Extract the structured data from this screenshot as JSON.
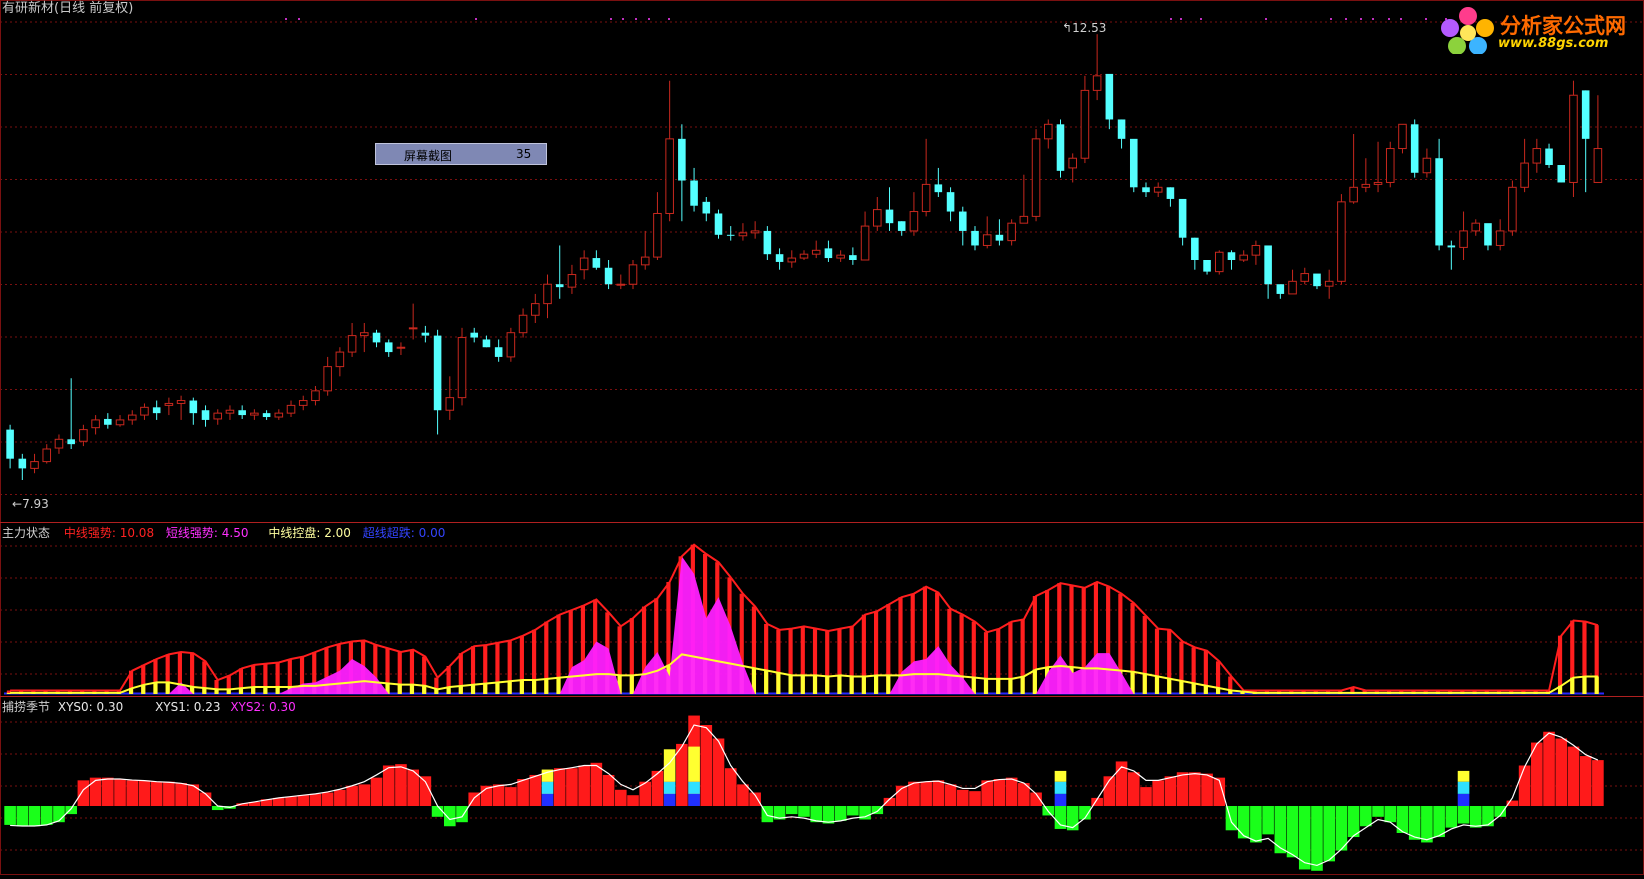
{
  "header": {
    "title": "有研新材(日线 前复权)",
    "popup_label": "屏幕截图",
    "popup_value": "35",
    "max_label": "12.53",
    "min_label": "7.93"
  },
  "logo": {
    "name": "分析家公式网",
    "url": "www.88gs.com"
  },
  "colors": {
    "bg": "#000000",
    "up": "#c8281e",
    "down": "#54ffff",
    "grid": "#7a1010",
    "mid": "#ff1e1e",
    "short": "#ff20ff",
    "ctrl": "#ffff30",
    "super": "#2828ff",
    "pos": "#ff1a1a",
    "neg": "#1aff1a",
    "line": "#ffffff"
  },
  "panel2": {
    "name": "主力状态",
    "items": [
      {
        "label": "中线强势:",
        "value": "10.08",
        "color": "#ff2222"
      },
      {
        "label": "短线强势:",
        "value": "4.50",
        "color": "#ff30ff"
      },
      {
        "label": "中线控盘:",
        "value": "2.00",
        "color": "#ffffa0"
      },
      {
        "label": "超线超跌:",
        "value": "0.00",
        "color": "#3344ff"
      }
    ]
  },
  "panel3": {
    "name": "捕捞季节",
    "items": [
      {
        "label": "XYS0:",
        "value": "0.30",
        "color": "#e8e8e8"
      },
      {
        "label": "XYS1:",
        "value": "0.23",
        "color": "#e8e8e8"
      },
      {
        "label": "XYS2:",
        "value": "0.30",
        "color": "#ff30ff"
      }
    ]
  },
  "chart_data": {
    "type": "candlestick",
    "ylim": [
      7.6,
      12.8
    ],
    "close": [
      8.15,
      8.05,
      8.12,
      8.25,
      8.35,
      8.3,
      8.45,
      8.55,
      8.5,
      8.55,
      8.6,
      8.68,
      8.62,
      8.72,
      8.75,
      8.62,
      8.55,
      8.62,
      8.65,
      8.6,
      8.62,
      8.58,
      8.62,
      8.7,
      8.75,
      8.85,
      9.1,
      9.25,
      9.42,
      9.45,
      9.35,
      9.25,
      9.3,
      9.5,
      9.42,
      8.65,
      8.78,
      9.4,
      9.4,
      9.3,
      9.2,
      9.45,
      9.63,
      9.75,
      9.95,
      9.92,
      10.05,
      10.22,
      10.12,
      9.95,
      9.95,
      10.15,
      10.23,
      10.68,
      11.45,
      11.02,
      10.76,
      10.68,
      10.46,
      10.45,
      10.48,
      10.5,
      10.26,
      10.18,
      10.22,
      10.26,
      10.3,
      10.22,
      10.25,
      10.2,
      10.55,
      10.72,
      10.58,
      10.5,
      10.7,
      10.98,
      10.9,
      10.7,
      10.5,
      10.35,
      10.46,
      10.4,
      10.58,
      10.65,
      11.45,
      11.6,
      11.12,
      11.25,
      11.95,
      12.1,
      11.65,
      11.45,
      10.95,
      10.9,
      10.95,
      10.83,
      10.43,
      10.2,
      10.08,
      10.28,
      10.2,
      10.25,
      10.35,
      9.95,
      9.85,
      9.98,
      10.06,
      9.93,
      9.98,
      10.8,
      10.95,
      10.98,
      11.0,
      11.35,
      11.6,
      11.1,
      11.25,
      10.35,
      10.33,
      10.5,
      10.58,
      10.35,
      10.5,
      10.95,
      11.2,
      11.35,
      11.18,
      11.0,
      11.9,
      11.45,
      11.35
    ],
    "open": [
      8.45,
      8.15,
      8.05,
      8.12,
      8.26,
      8.35,
      8.33,
      8.47,
      8.56,
      8.5,
      8.55,
      8.6,
      8.68,
      8.7,
      8.72,
      8.75,
      8.65,
      8.56,
      8.62,
      8.65,
      8.6,
      8.62,
      8.58,
      8.62,
      8.7,
      8.75,
      8.85,
      9.1,
      9.25,
      9.42,
      9.45,
      9.35,
      9.3,
      9.5,
      9.45,
      9.42,
      8.65,
      8.78,
      9.45,
      9.38,
      9.3,
      9.2,
      9.45,
      9.63,
      9.75,
      9.95,
      9.92,
      10.1,
      10.22,
      10.12,
      9.95,
      9.95,
      10.15,
      10.23,
      10.68,
      11.45,
      11.02,
      10.8,
      10.68,
      10.46,
      10.45,
      10.48,
      10.5,
      10.26,
      10.18,
      10.22,
      10.26,
      10.32,
      10.22,
      10.25,
      10.2,
      10.55,
      10.72,
      10.6,
      10.5,
      10.7,
      10.98,
      10.9,
      10.7,
      10.5,
      10.35,
      10.46,
      10.4,
      10.58,
      10.65,
      11.45,
      11.6,
      11.15,
      11.25,
      11.95,
      12.12,
      11.65,
      11.45,
      10.95,
      10.9,
      10.95,
      10.83,
      10.43,
      10.2,
      10.08,
      10.28,
      10.2,
      10.25,
      10.35,
      9.95,
      9.85,
      9.98,
      10.06,
      9.93,
      9.98,
      10.8,
      10.95,
      10.98,
      11.0,
      11.35,
      11.6,
      11.1,
      11.25,
      10.35,
      10.33,
      10.5,
      10.58,
      10.35,
      10.5,
      10.95,
      11.2,
      11.35,
      11.18,
      11.0,
      11.95,
      11.0
    ],
    "high": [
      8.5,
      8.2,
      8.2,
      8.3,
      8.4,
      8.98,
      8.5,
      8.6,
      8.62,
      8.6,
      8.65,
      8.72,
      8.75,
      8.78,
      8.8,
      8.78,
      8.7,
      8.66,
      8.7,
      8.7,
      8.66,
      8.65,
      8.66,
      8.75,
      8.8,
      8.9,
      9.2,
      9.3,
      9.55,
      9.55,
      9.48,
      9.38,
      9.35,
      9.75,
      9.52,
      9.48,
      9.0,
      9.5,
      9.5,
      9.42,
      9.38,
      9.5,
      9.7,
      9.85,
      10.05,
      10.35,
      10.15,
      10.3,
      10.3,
      10.2,
      10.05,
      10.2,
      10.5,
      10.9,
      12.05,
      11.6,
      11.15,
      10.85,
      10.72,
      10.55,
      10.58,
      10.6,
      10.55,
      10.32,
      10.3,
      10.3,
      10.4,
      10.4,
      10.3,
      10.33,
      10.7,
      10.85,
      10.95,
      10.6,
      10.9,
      11.45,
      11.15,
      10.95,
      10.75,
      10.55,
      10.65,
      10.62,
      10.62,
      11.08,
      11.55,
      11.65,
      11.65,
      11.3,
      12.1,
      12.53,
      12.0,
      11.65,
      11.4,
      11.0,
      11.0,
      10.95,
      10.62,
      10.43,
      10.2,
      10.3,
      10.3,
      10.3,
      10.4,
      10.0,
      9.9,
      10.1,
      10.12,
      10.05,
      10.1,
      10.88,
      11.5,
      11.25,
      11.42,
      11.42,
      11.6,
      11.65,
      11.35,
      11.45,
      10.4,
      10.7,
      10.62,
      10.55,
      10.62,
      11.02,
      11.45,
      11.45,
      11.4,
      11.18,
      12.05,
      11.95,
      11.9
    ],
    "low": [
      8.05,
      7.93,
      8.0,
      8.1,
      8.2,
      8.25,
      8.28,
      8.4,
      8.46,
      8.48,
      8.5,
      8.55,
      8.55,
      8.6,
      8.55,
      8.5,
      8.48,
      8.5,
      8.55,
      8.56,
      8.55,
      8.55,
      8.55,
      8.58,
      8.65,
      8.7,
      8.8,
      9.0,
      9.2,
      9.25,
      9.3,
      9.2,
      9.22,
      9.38,
      9.35,
      8.4,
      8.55,
      8.7,
      9.35,
      9.3,
      9.15,
      9.15,
      9.4,
      9.55,
      9.6,
      9.8,
      9.85,
      10.0,
      10.1,
      9.9,
      9.9,
      9.9,
      10.1,
      10.2,
      10.6,
      10.6,
      10.7,
      10.6,
      10.42,
      10.4,
      10.4,
      10.42,
      10.2,
      10.1,
      10.12,
      10.2,
      10.22,
      10.18,
      10.18,
      10.15,
      10.2,
      10.5,
      10.5,
      10.45,
      10.45,
      10.65,
      10.85,
      10.6,
      10.35,
      10.3,
      10.32,
      10.35,
      10.35,
      10.6,
      10.6,
      11.35,
      11.05,
      11.0,
      11.2,
      11.85,
      11.55,
      11.35,
      10.9,
      10.85,
      10.85,
      10.75,
      10.35,
      10.1,
      10.05,
      10.05,
      10.1,
      10.18,
      10.15,
      9.8,
      9.8,
      9.85,
      9.95,
      9.9,
      9.8,
      9.95,
      10.78,
      10.9,
      10.9,
      10.95,
      11.3,
      11.05,
      11.05,
      10.3,
      10.1,
      10.2,
      10.45,
      10.3,
      10.3,
      10.45,
      10.9,
      11.1,
      11.15,
      11.0,
      10.85,
      10.9,
      11.3
    ],
    "mid_strength": [
      0.3,
      0.3,
      0.3,
      0.3,
      0.3,
      0.3,
      0.3,
      0.3,
      0.3,
      0.3,
      2.0,
      2.5,
      3.0,
      3.4,
      3.6,
      3.5,
      2.8,
      1.2,
      1.6,
      2.2,
      2.5,
      2.6,
      2.7,
      3.0,
      3.2,
      3.6,
      4.0,
      4.3,
      4.5,
      4.6,
      4.2,
      3.9,
      3.6,
      3.8,
      3.2,
      1.4,
      2.4,
      3.5,
      4.1,
      4.2,
      4.4,
      4.6,
      5.0,
      5.5,
      6.2,
      6.8,
      7.2,
      7.6,
      8.1,
      7.0,
      5.8,
      6.5,
      7.5,
      8.2,
      9.6,
      11.8,
      12.8,
      12.0,
      11.3,
      10.0,
      8.6,
      7.5,
      6.0,
      5.5,
      5.6,
      5.8,
      5.6,
      5.4,
      5.6,
      5.8,
      6.8,
      7.1,
      7.7,
      8.3,
      8.6,
      9.2,
      8.7,
      7.3,
      6.8,
      6.2,
      5.3,
      5.6,
      6.2,
      6.4,
      8.4,
      8.9,
      9.5,
      9.3,
      9.1,
      9.6,
      9.2,
      8.6,
      7.8,
      6.7,
      5.6,
      5.5,
      4.5,
      4.0,
      3.7,
      2.8,
      1.5,
      0.3,
      0.3,
      0.3,
      0.3,
      0.3,
      0.3,
      0.3,
      0.3,
      0.3,
      0.6,
      0.3,
      0.3,
      0.3,
      0.3,
      0.3,
      0.3,
      0.3,
      0.3,
      0.3,
      0.3,
      0.3,
      0.3,
      0.3,
      0.3,
      0.3,
      0.3,
      5.0,
      6.3,
      6.2,
      5.9,
      7.4,
      7.0,
      4.2,
      3.7,
      3.3,
      1.8,
      1.0,
      0.6,
      0.3,
      1.3,
      5.0,
      7.0,
      8.0,
      7.5,
      8.0,
      8.6,
      6.0,
      4.5,
      6.8
    ],
    "short_strength": [
      0,
      0,
      0,
      0,
      0,
      0,
      0,
      0,
      0,
      0,
      0,
      0,
      0,
      0,
      1.0,
      0,
      0,
      0,
      0,
      0,
      0,
      0,
      0,
      0.5,
      0.9,
      1.0,
      1.5,
      2.0,
      3.0,
      2.4,
      1.4,
      0,
      0,
      0,
      0,
      0,
      0,
      0,
      0,
      0,
      0,
      0,
      0,
      0,
      0,
      0,
      2.3,
      2.9,
      4.5,
      3.9,
      0,
      0,
      2.3,
      3.6,
      1.5,
      11.8,
      10.3,
      6.5,
      8.3,
      5.8,
      2.6,
      0,
      0,
      0,
      0,
      0,
      0,
      0,
      0,
      0,
      0,
      0,
      0,
      1.9,
      2.8,
      3.0,
      4.1,
      2.5,
      1.4,
      0,
      0,
      0,
      0,
      0,
      0,
      1.9,
      3.3,
      1.8,
      2.3,
      3.5,
      3.5,
      1.8,
      0,
      0,
      0,
      0,
      0,
      0,
      0,
      0,
      0,
      0,
      0,
      0,
      0,
      0,
      0,
      0,
      0,
      0,
      0,
      0,
      0,
      0,
      0,
      0,
      0,
      0,
      0,
      0,
      0,
      0,
      0,
      0,
      0,
      0,
      0,
      0,
      0,
      0,
      0,
      0,
      0,
      0,
      0,
      0,
      0,
      0,
      0,
      0,
      0,
      0,
      0,
      0,
      0,
      0,
      0,
      0,
      0,
      0,
      0,
      0,
      0,
      0,
      0,
      1.8,
      3.0,
      0,
      2.5,
      4.5,
      2.0,
      3.5
    ],
    "ctrl": [
      0.1,
      0.1,
      0.1,
      0.1,
      0.1,
      0.1,
      0.1,
      0.1,
      0.1,
      0.1,
      0.5,
      0.8,
      1.0,
      1.0,
      0.8,
      0.6,
      0.5,
      0.4,
      0.4,
      0.5,
      0.6,
      0.6,
      0.6,
      0.6,
      0.7,
      0.7,
      0.8,
      0.9,
      1.0,
      1.1,
      1.0,
      0.9,
      0.8,
      0.8,
      0.7,
      0.4,
      0.6,
      0.7,
      0.8,
      0.9,
      1.0,
      1.1,
      1.2,
      1.2,
      1.3,
      1.4,
      1.5,
      1.6,
      1.7,
      1.7,
      1.6,
      1.6,
      1.7,
      2.0,
      2.5,
      3.4,
      3.2,
      3.0,
      2.8,
      2.6,
      2.4,
      2.2,
      2.0,
      1.8,
      1.6,
      1.6,
      1.6,
      1.5,
      1.6,
      1.5,
      1.5,
      1.6,
      1.6,
      1.6,
      1.7,
      1.7,
      1.7,
      1.6,
      1.5,
      1.4,
      1.3,
      1.3,
      1.3,
      1.5,
      2.1,
      2.3,
      2.4,
      2.3,
      2.2,
      2.2,
      2.1,
      2.0,
      1.9,
      1.7,
      1.5,
      1.3,
      1.1,
      0.9,
      0.7,
      0.5,
      0.3,
      0.2,
      0.1,
      0.1,
      0.1,
      0.1,
      0.1,
      0.1,
      0.1,
      0.1,
      0.1,
      0.1,
      0.1,
      0.1,
      0.1,
      0.1,
      0.1,
      0.1,
      0.1,
      0.1,
      0.1,
      0.1,
      0.1,
      0.1,
      0.1,
      0.1,
      0.1,
      0.7,
      1.4,
      1.5,
      1.5,
      1.5,
      1.6,
      1.4,
      1.2,
      1.0,
      0.8,
      0.6,
      0.4,
      0.3,
      0.6,
      1.2,
      1.5,
      1.8,
      1.8,
      1.9,
      2.0,
      1.9,
      1.8,
      2.0
    ],
    "xys0": [
      -0.7,
      -0.75,
      -0.75,
      -0.7,
      -0.6,
      -0.3,
      0.95,
      1.05,
      1.05,
      1.0,
      0.95,
      0.95,
      0.9,
      0.9,
      0.85,
      0.8,
      0.5,
      -0.15,
      -0.1,
      0.1,
      0.15,
      0.25,
      0.3,
      0.35,
      0.4,
      0.45,
      0.5,
      0.6,
      0.75,
      0.8,
      1.05,
      1.5,
      1.55,
      1.35,
      1.1,
      -0.4,
      -0.75,
      -0.6,
      0.5,
      0.75,
      0.8,
      0.7,
      1.0,
      1.15,
      1.3,
      1.4,
      1.4,
      1.5,
      1.6,
      1.15,
      0.6,
      0.4,
      0.9,
      1.3,
      1.7,
      2.3,
      3.35,
      3.0,
      2.5,
      1.4,
      0.8,
      0.5,
      -0.6,
      -0.5,
      -0.3,
      -0.4,
      -0.6,
      -0.65,
      -0.55,
      -0.35,
      -0.5,
      -0.3,
      0.3,
      0.75,
      0.9,
      0.9,
      0.95,
      0.8,
      0.6,
      0.55,
      0.95,
      1.0,
      1.05,
      0.85,
      0.5,
      -0.35,
      -0.85,
      -0.9,
      -0.5,
      0.3,
      1.1,
      1.65,
      1.25,
      0.7,
      0.95,
      1.1,
      1.25,
      1.25,
      1.2,
      1.05,
      -0.9,
      -1.2,
      -1.35,
      -1.05,
      -1.75,
      -1.9,
      -2.35,
      -2.4,
      -2.05,
      -1.65,
      -1.15,
      -0.75,
      -0.4,
      -0.6,
      -1.0,
      -1.25,
      -1.35,
      -1.15,
      -0.8,
      -0.65,
      -0.8,
      -0.75,
      -0.4,
      0.2,
      1.5,
      2.35,
      2.75,
      2.5,
      2.2,
      1.85,
      1.7,
      1.3,
      1.0,
      0.55,
      0.3,
      -1.4,
      -2.1,
      -2.4,
      -1.9,
      -1.35,
      -1.0,
      -0.6,
      -0.3,
      0.3,
      1.0,
      1.5,
      1.25,
      1.3,
      1.2,
      1.1,
      1.15,
      1.05,
      0.25,
      0.3
    ],
    "xys2_line": [
      -0.72,
      -0.74,
      -0.74,
      -0.7,
      -0.55,
      -0.1,
      0.6,
      0.95,
      1.0,
      1.0,
      0.96,
      0.94,
      0.9,
      0.88,
      0.84,
      0.75,
      0.45,
      0.0,
      -0.05,
      0.08,
      0.15,
      0.23,
      0.3,
      0.35,
      0.4,
      0.45,
      0.52,
      0.62,
      0.75,
      0.9,
      1.15,
      1.42,
      1.45,
      1.3,
      0.9,
      0.0,
      -0.5,
      -0.4,
      0.3,
      0.65,
      0.75,
      0.8,
      0.95,
      1.1,
      1.25,
      1.35,
      1.42,
      1.5,
      1.5,
      1.2,
      0.8,
      0.6,
      0.85,
      1.2,
      1.6,
      2.2,
      3.0,
      2.9,
      2.4,
      1.5,
      0.9,
      0.4,
      -0.35,
      -0.45,
      -0.4,
      -0.45,
      -0.55,
      -0.6,
      -0.55,
      -0.45,
      -0.4,
      -0.2,
      0.25,
      0.65,
      0.85,
      0.9,
      0.92,
      0.8,
      0.65,
      0.65,
      0.9,
      0.98,
      1.0,
      0.85,
      0.45,
      -0.2,
      -0.7,
      -0.8,
      -0.45,
      0.25,
      0.95,
      1.45,
      1.3,
      0.95,
      0.95,
      1.05,
      1.15,
      1.2,
      1.15,
      0.95,
      -0.6,
      -1.1,
      -1.3,
      -1.2,
      -1.55,
      -1.8,
      -2.1,
      -2.2,
      -2.0,
      -1.6,
      -1.1,
      -0.8,
      -0.5,
      -0.6,
      -0.95,
      -1.15,
      -1.25,
      -1.1,
      -0.85,
      -0.7,
      -0.75,
      -0.7,
      -0.35,
      0.3,
      1.45,
      2.3,
      2.7,
      2.55,
      2.25,
      1.9,
      1.7,
      1.35,
      1.0,
      0.6,
      0.2,
      -1.1,
      -1.8,
      -2.2,
      -1.9,
      -1.4,
      -1.0,
      -0.65,
      -0.3,
      0.3,
      0.95,
      1.4,
      1.3,
      1.3,
      1.2,
      1.1,
      1.1,
      0.95,
      0.35,
      0.3
    ]
  }
}
